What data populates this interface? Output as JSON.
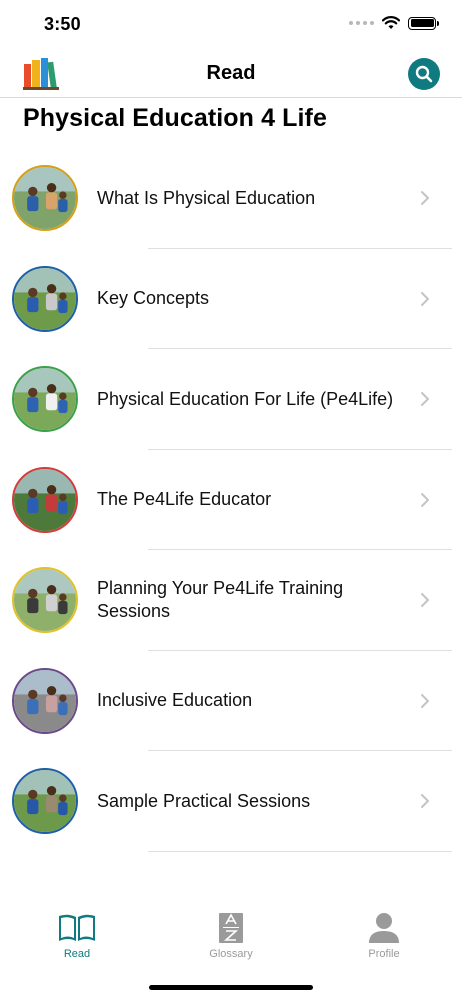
{
  "status_bar": {
    "time": "3:50"
  },
  "nav": {
    "title": "Read",
    "logo_icon": "books-icon",
    "search_icon": "search-icon"
  },
  "page": {
    "title": "Physical Education 4 Life"
  },
  "colors": {
    "accent": "#0f7a80",
    "separator": "#e0e0e0",
    "inactive": "#9a9a9a"
  },
  "chapters": [
    {
      "label": "What Is Physical Education",
      "ring": "#d4a017"
    },
    {
      "label": "Key Concepts",
      "ring": "#1f5fa8"
    },
    {
      "label": "Physical Education For Life (Pe4Life)",
      "ring": "#3aa14a"
    },
    {
      "label": "The Pe4Life Educator",
      "ring": "#d23c3c"
    },
    {
      "label": "Planning Your Pe4Life Training Sessions",
      "ring": "#e0c22a"
    },
    {
      "label": "Inclusive Education",
      "ring": "#6a4a8a"
    },
    {
      "label": "Sample Practical Sessions",
      "ring": "#1f5fa8"
    }
  ],
  "tabs": [
    {
      "label": "Read",
      "icon": "book-icon",
      "active": true
    },
    {
      "label": "Glossary",
      "icon": "glossary-icon",
      "active": false
    },
    {
      "label": "Profile",
      "icon": "person-icon",
      "active": false
    }
  ]
}
